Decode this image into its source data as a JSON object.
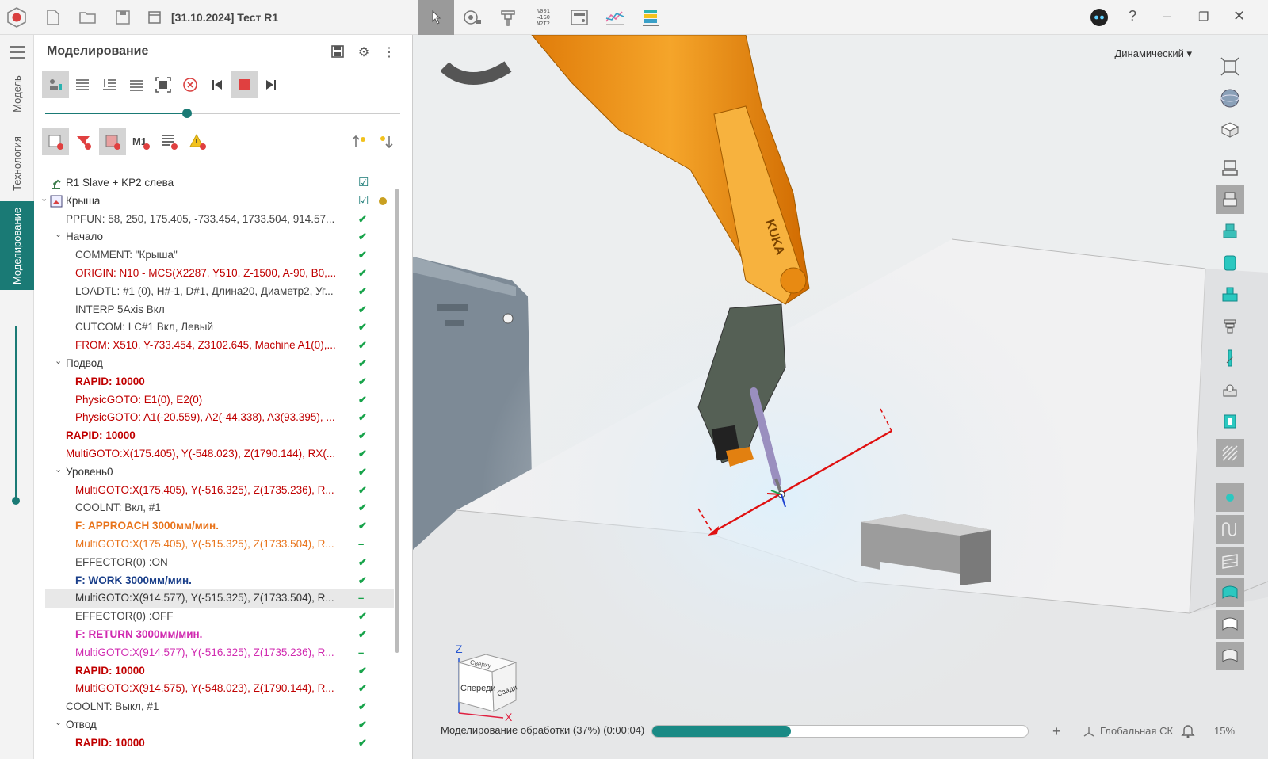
{
  "window": {
    "title": "[31.10.2024] Тест R1"
  },
  "top_tools": [
    "select-tool-icon",
    "camera-icon",
    "tool-holder-icon",
    "nc-code-icon",
    "calculator-icon",
    "graph-icon",
    "layers-icon"
  ],
  "top_tools_nc_label": "%001 →1G0 N2T2",
  "vtabs": {
    "model": "Модель",
    "technology": "Технология",
    "simulation": "Моделирование"
  },
  "panel": {
    "title": "Моделирование"
  },
  "simulation_slider_progress": 0.4,
  "tree": [
    {
      "text": "R1 Slave + KP2 слева",
      "indent": 1,
      "color": "#333",
      "bold": false,
      "check": "☑",
      "icon": "robot"
    },
    {
      "text": "Крыша",
      "indent": 1,
      "color": "#333",
      "bold": false,
      "check": "☑",
      "arrow": "v",
      "icon": "op"
    },
    {
      "text": "PPFUN: 58, 250, 175.405, -733.454, 1733.504, 914.57...",
      "indent": 2,
      "color": "#444",
      "bold": false,
      "check": "✔"
    },
    {
      "text": "Начало",
      "indent": 2,
      "color": "#333",
      "bold": false,
      "check": "✔",
      "arrow": "v"
    },
    {
      "text": "COMMENT: \"Крыша\"",
      "indent": 3,
      "color": "#444",
      "bold": false,
      "check": "✔"
    },
    {
      "text": "ORIGIN: N10 - MCS(X2287, Y510, Z-1500, A-90, B0,...",
      "indent": 3,
      "color": "#c00000",
      "bold": false,
      "check": "✔"
    },
    {
      "text": "LOADTL: #1 (0), H#-1, D#1, Длина20, Диаметр2, Уг...",
      "indent": 3,
      "color": "#444",
      "bold": false,
      "check": "✔"
    },
    {
      "text": "INTERP 5Axis Вкл",
      "indent": 3,
      "color": "#444",
      "bold": false,
      "check": "✔"
    },
    {
      "text": "CUTCOM: LC#1 Вкл, Левый",
      "indent": 3,
      "color": "#444",
      "bold": false,
      "check": "✔"
    },
    {
      "text": "FROM: X510, Y-733.454, Z3102.645, Machine A1(0),...",
      "indent": 3,
      "color": "#c00000",
      "bold": false,
      "check": "✔"
    },
    {
      "text": "Подвод",
      "indent": 2,
      "color": "#333",
      "bold": false,
      "check": "✔",
      "arrow": "v"
    },
    {
      "text": "RAPID: 10000",
      "indent": 3,
      "color": "#c00000",
      "bold": true,
      "check": "✔"
    },
    {
      "text": "PhysicGOTO: E1(0), E2(0)",
      "indent": 3,
      "color": "#c00000",
      "bold": false,
      "check": "✔"
    },
    {
      "text": "PhysicGOTO: A1(-20.559), A2(-44.338), A3(93.395), ...",
      "indent": 3,
      "color": "#c00000",
      "bold": false,
      "check": "✔"
    },
    {
      "text": "RAPID: 10000",
      "indent": 2,
      "color": "#c00000",
      "bold": true,
      "check": "✔"
    },
    {
      "text": "MultiGOTO:X(175.405), Y(-548.023), Z(1790.144), RX(...",
      "indent": 2,
      "color": "#c00000",
      "bold": false,
      "check": "✔"
    },
    {
      "text": "Уровень0",
      "indent": 2,
      "color": "#333",
      "bold": false,
      "check": "✔",
      "arrow": "v"
    },
    {
      "text": "MultiGOTO:X(175.405), Y(-516.325), Z(1735.236), R...",
      "indent": 3,
      "color": "#c00000",
      "bold": false,
      "check": "✔"
    },
    {
      "text": "COOLNT: Вкл, #1",
      "indent": 3,
      "color": "#444",
      "bold": false,
      "check": "✔"
    },
    {
      "text": "F: APPROACH 3000мм/мин.",
      "indent": 3,
      "color": "#e8731a",
      "bold": true,
      "check": "✔"
    },
    {
      "text": "MultiGOTO:X(175.405), Y(-515.325), Z(1733.504), R...",
      "indent": 3,
      "color": "#e8731a",
      "bold": false,
      "check": "–"
    },
    {
      "text": "EFFECTOR(0) :ON",
      "indent": 3,
      "color": "#444",
      "bold": false,
      "check": "✔"
    },
    {
      "text": "F: WORK 3000мм/мин.",
      "indent": 3,
      "color": "#1a3f8a",
      "bold": true,
      "check": "✔"
    },
    {
      "text": "MultiGOTO:X(914.577), Y(-515.325), Z(1733.504), R...",
      "indent": 3,
      "color": "#333",
      "bold": false,
      "check": "–",
      "highlight": true
    },
    {
      "text": "EFFECTOR(0) :OFF",
      "indent": 3,
      "color": "#444",
      "bold": false,
      "check": "✔"
    },
    {
      "text": "F: RETURN 3000мм/мин.",
      "indent": 3,
      "color": "#d02ab0",
      "bold": true,
      "check": "✔"
    },
    {
      "text": "MultiGOTO:X(914.577), Y(-516.325), Z(1735.236), R...",
      "indent": 3,
      "color": "#d02ab0",
      "bold": false,
      "check": "–"
    },
    {
      "text": "RAPID: 10000",
      "indent": 3,
      "color": "#c00000",
      "bold": true,
      "check": "✔"
    },
    {
      "text": "MultiGOTO:X(914.575), Y(-548.023), Z(1790.144), R...",
      "indent": 3,
      "color": "#c00000",
      "bold": false,
      "check": "✔"
    },
    {
      "text": "COOLNT: Выкл, #1",
      "indent": 2,
      "color": "#444",
      "bold": false,
      "check": "✔"
    },
    {
      "text": "Отвод",
      "indent": 2,
      "color": "#333",
      "bold": false,
      "check": "✔",
      "arrow": "v"
    },
    {
      "text": "RAPID: 10000",
      "indent": 3,
      "color": "#c00000",
      "bold": true,
      "check": "✔"
    }
  ],
  "viewport": {
    "mode": "Динамический ▾",
    "cube_top": "Сверху",
    "cube_front": "Спереди",
    "cube_back": "Сзади",
    "axis_z": "Z",
    "axis_x": "X",
    "robot_brand": "KUKA"
  },
  "status": {
    "label": "Моделирование обработки (37%) (0:00:04)",
    "progress": 0.37,
    "cs": "Глобальная СК",
    "zoom": "15%"
  },
  "colors": {
    "accent": "#1a7a75",
    "robot_orange": "#f29a1f"
  }
}
